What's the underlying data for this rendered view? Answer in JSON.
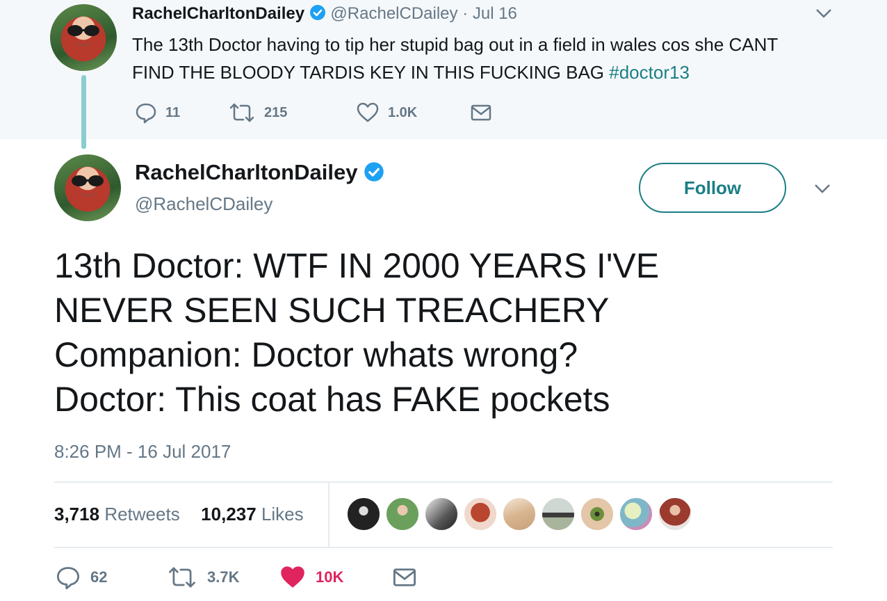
{
  "parent_tweet": {
    "name": "RachelCharltonDailey",
    "handle": "@RachelCDailey",
    "separator": "·",
    "date": "Jul 16",
    "text_plain": "The 13th Doctor having to tip her stupid bag out in a field in wales cos she CANT",
    "text_line2": "FIND THE BLOODY TARDIS KEY IN THIS FUCKING BAG ",
    "hashtag": "#doctor13",
    "replies": "11",
    "retweets": "215",
    "likes": "1.0K"
  },
  "main_tweet": {
    "name": "RachelCharltonDailey",
    "handle": "@RachelCDailey",
    "follow_label": "Follow",
    "lines": [
      "13th Doctor: WTF IN 2000 YEARS I'VE",
      "NEVER SEEN SUCH TREACHERY",
      "Companion: Doctor whats wrong?",
      "Doctor: This coat has FAKE pockets"
    ],
    "timestamp": "8:26 PM - 16 Jul 2017",
    "retweet_count": "3,718",
    "retweet_label": "Retweets",
    "like_count": "10,237",
    "like_label": "Likes",
    "actions": {
      "replies": "62",
      "retweets": "3.7K",
      "likes": "10K"
    },
    "liker_avatar_count": 9
  },
  "colors": {
    "accent": "#1b7e85",
    "verified": "#1da1f2",
    "muted": "#657786",
    "like": "#e0245e",
    "thread_line": "#8ccdd0"
  },
  "icons": [
    "verified-badge-icon",
    "chevron-down-icon",
    "reply-icon",
    "retweet-icon",
    "heart-icon",
    "envelope-icon"
  ]
}
